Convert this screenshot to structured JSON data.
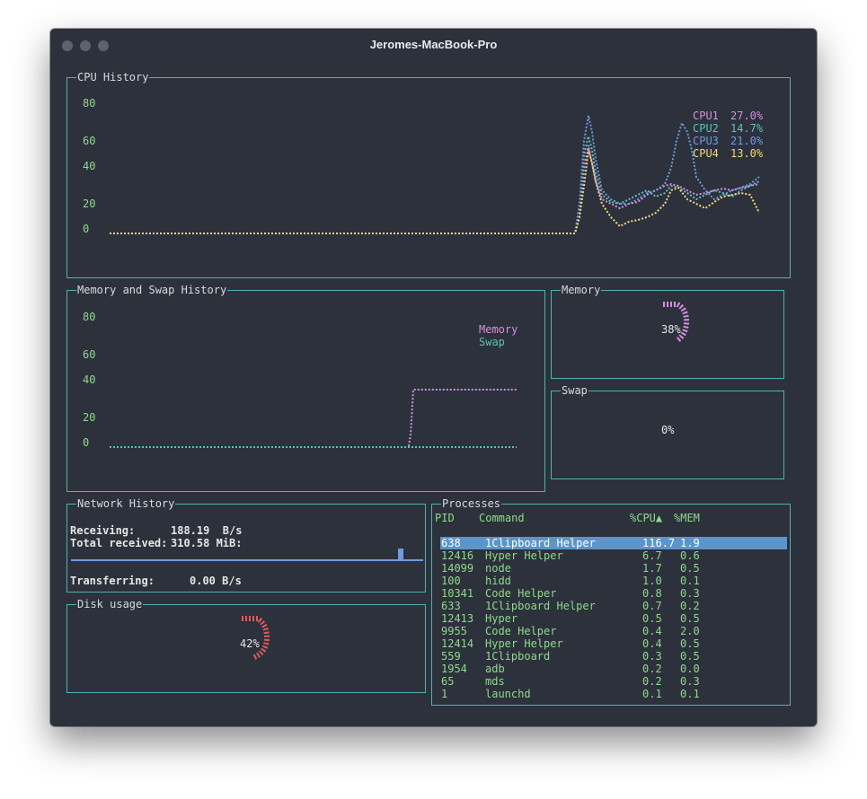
{
  "window": {
    "title": "Jeromes-MacBook-Pro"
  },
  "cpu": {
    "title": "CPU History",
    "ticks": [
      "80",
      "60",
      "40",
      "20",
      "0"
    ],
    "legend": [
      {
        "label": "CPU1",
        "value": "27.0%",
        "color": "#d58ee0"
      },
      {
        "label": "CPU2",
        "value": "14.7%",
        "color": "#5ec1bd"
      },
      {
        "label": "CPU3",
        "value": "21.0%",
        "color": "#6f9ae0"
      },
      {
        "label": "CPU4",
        "value": "13.0%",
        "color": "#f5d77a"
      }
    ]
  },
  "memory_history": {
    "title": "Memory and Swap History",
    "ticks": [
      "80",
      "60",
      "40",
      "20",
      "0"
    ],
    "legend": [
      {
        "label": "Memory",
        "color": "#d58ee0"
      },
      {
        "label": "Swap",
        "color": "#5ec1bd"
      }
    ]
  },
  "memory": {
    "title": "Memory",
    "value": "38%",
    "color": "#d58ee0"
  },
  "swap": {
    "title": "Swap",
    "value": "0%"
  },
  "network": {
    "title": "Network History",
    "receiving_label": "Receiving:",
    "receiving_value": "188.19  B/s",
    "total_label": "Total received:",
    "total_value": "310.58 MiB:",
    "transferring_label": "Transferring:",
    "transferring_value": "0.00 B/s",
    "color": "#6f9ae0"
  },
  "disk": {
    "title": "Disk usage",
    "value": "42%",
    "color": "#e05a5a"
  },
  "processes": {
    "title": "Processes",
    "headers": {
      "pid": "PID",
      "command": "Command",
      "cpu": "%CPU▲",
      "mem": "%MEM"
    },
    "rows": [
      {
        "pid": "638",
        "command": "1Clipboard Helper",
        "cpu": "116.7",
        "mem": "1.9"
      },
      {
        "pid": "12416",
        "command": "Hyper Helper",
        "cpu": "6.7",
        "mem": "0.6"
      },
      {
        "pid": "14099",
        "command": "node",
        "cpu": "1.7",
        "mem": "0.5"
      },
      {
        "pid": "100",
        "command": "hidd",
        "cpu": "1.0",
        "mem": "0.1"
      },
      {
        "pid": "10341",
        "command": "Code Helper",
        "cpu": "0.8",
        "mem": "0.3"
      },
      {
        "pid": "633",
        "command": "1Clipboard Helper",
        "cpu": "0.7",
        "mem": "0.2"
      },
      {
        "pid": "12413",
        "command": "Hyper",
        "cpu": "0.5",
        "mem": "0.5"
      },
      {
        "pid": "9955",
        "command": "Code Helper",
        "cpu": "0.4",
        "mem": "2.0"
      },
      {
        "pid": "12414",
        "command": "Hyper Helper",
        "cpu": "0.4",
        "mem": "0.5"
      },
      {
        "pid": "559",
        "command": "1Clipboard",
        "cpu": "0.3",
        "mem": "0.5"
      },
      {
        "pid": "1954",
        "command": "adb",
        "cpu": "0.2",
        "mem": "0.0"
      },
      {
        "pid": "65",
        "command": "mds",
        "cpu": "0.2",
        "mem": "0.3"
      },
      {
        "pid": "1",
        "command": "launchd",
        "cpu": "0.1",
        "mem": "0.1"
      }
    ]
  }
}
